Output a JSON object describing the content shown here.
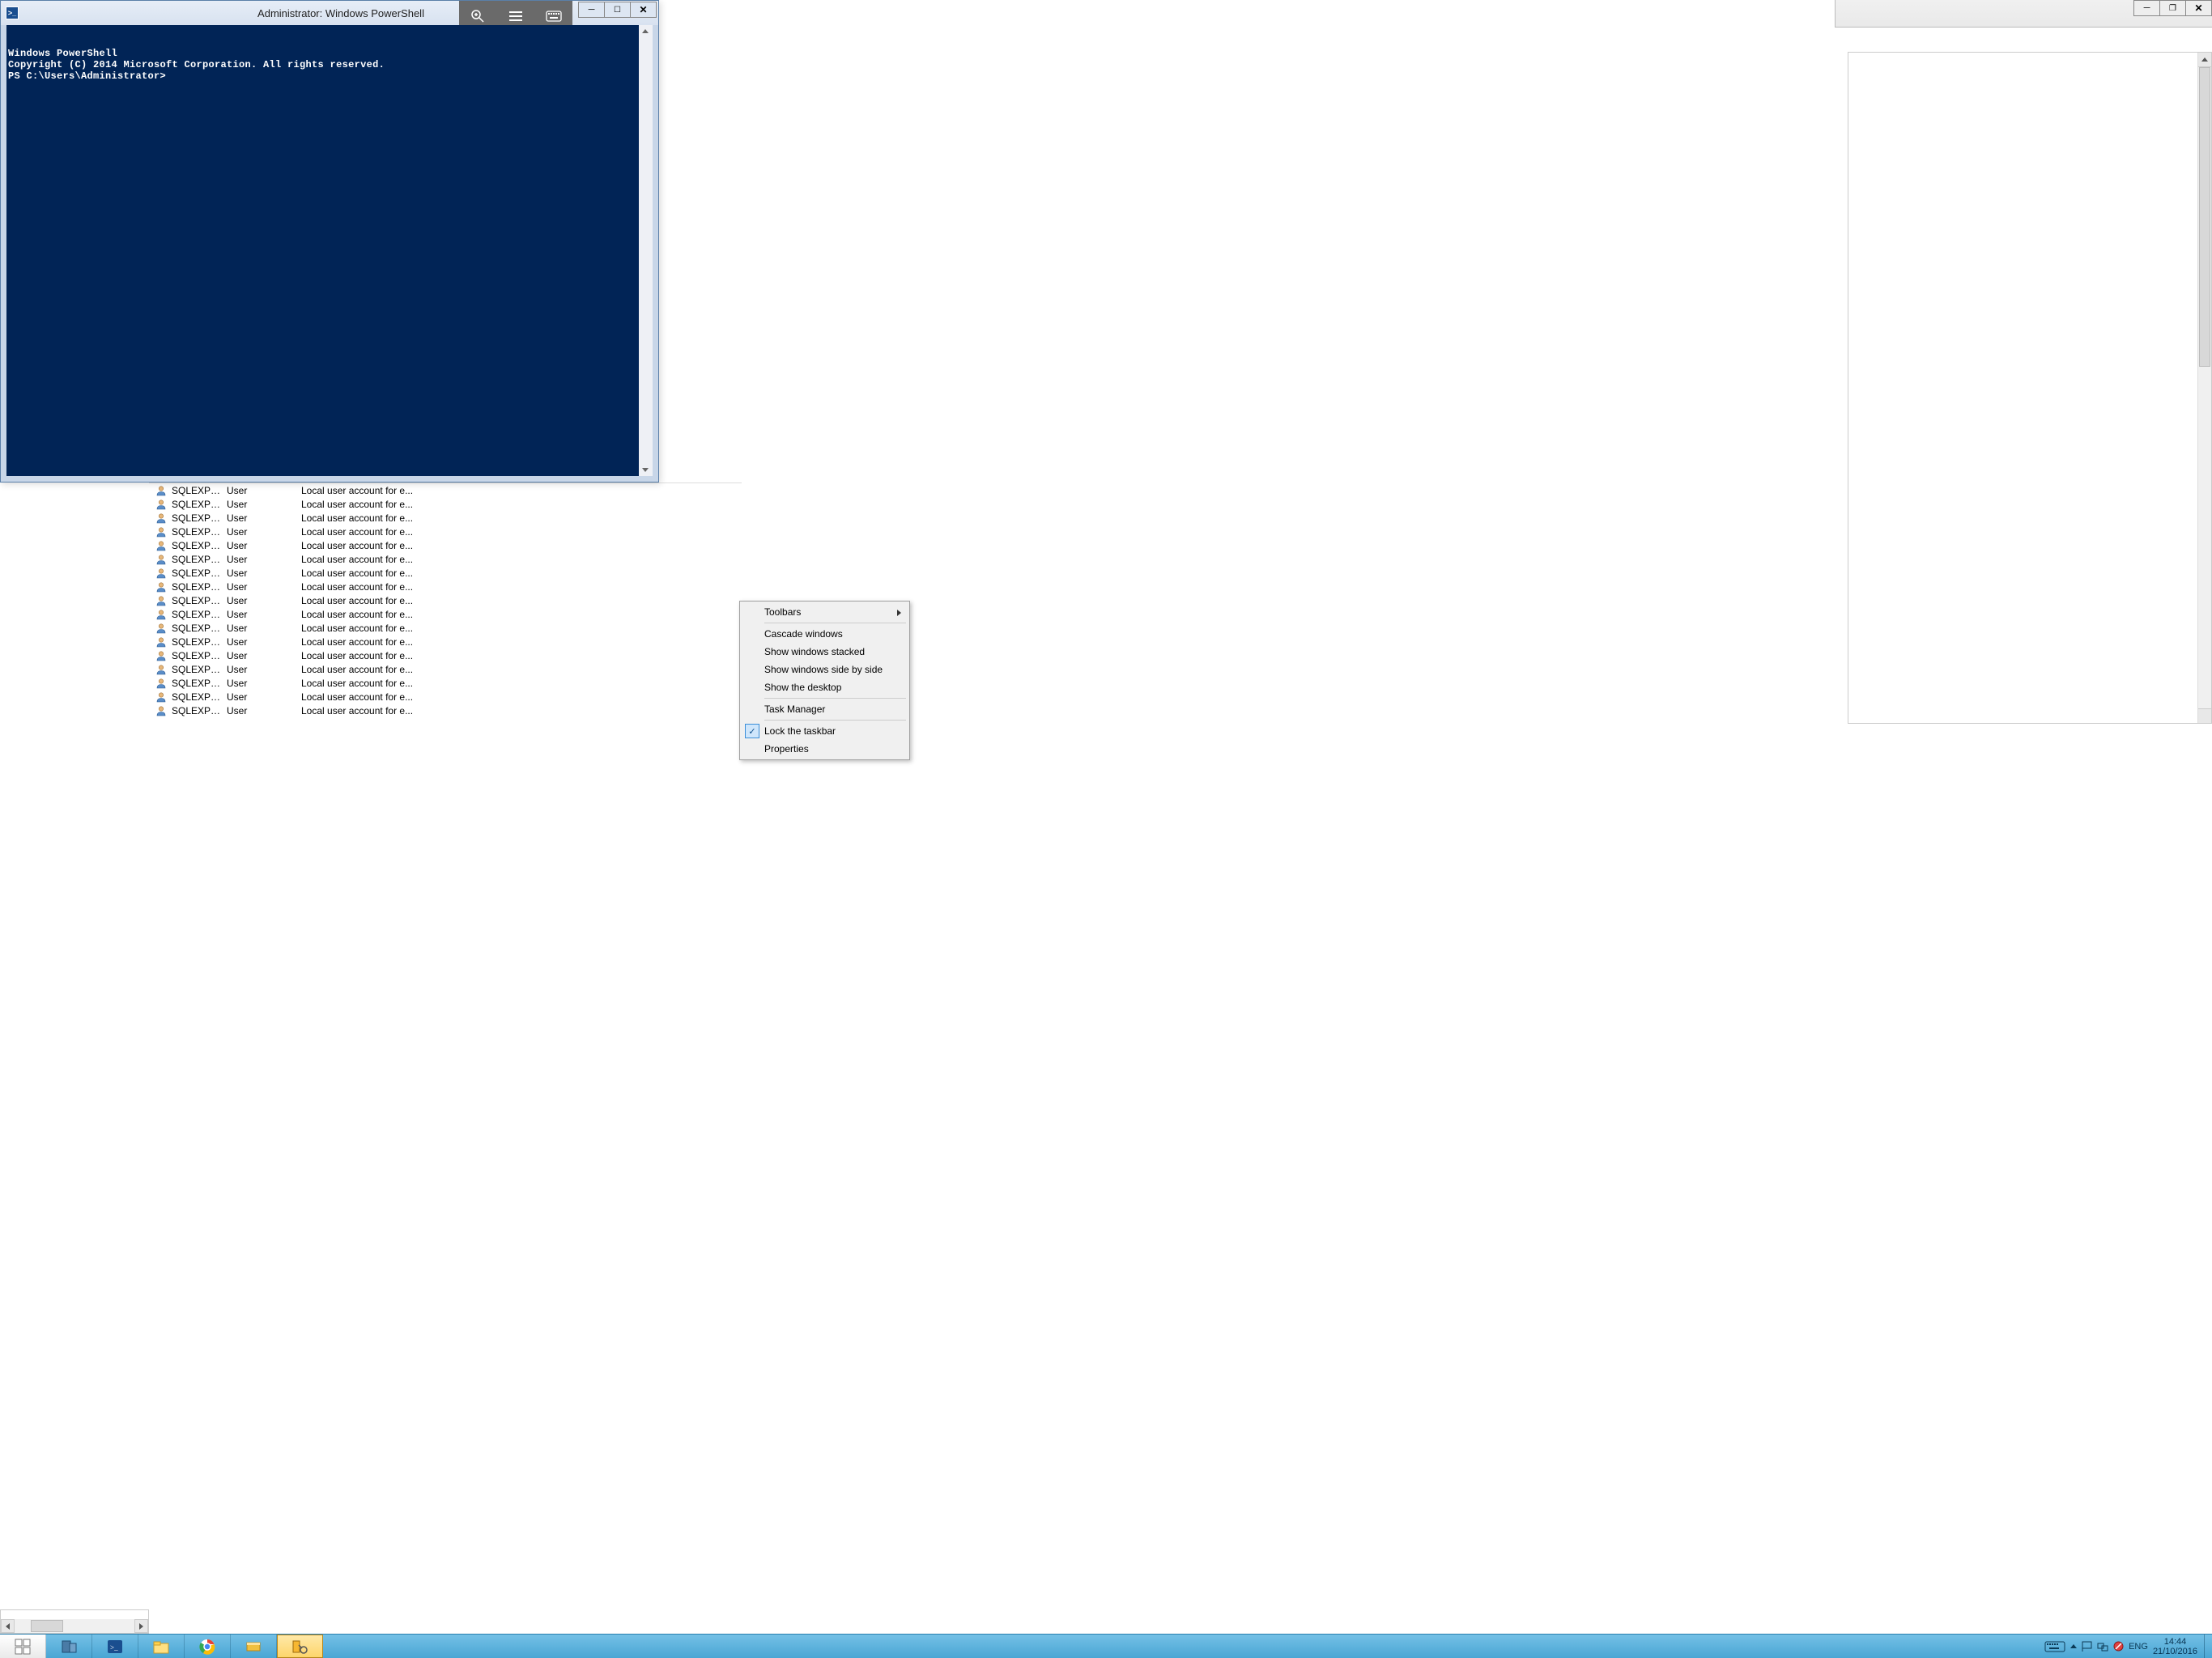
{
  "powershell": {
    "title": "Administrator: Windows PowerShell",
    "lines": [
      "Windows PowerShell",
      "Copyright (C) 2014 Microsoft Corporation. All rights reserved.",
      "",
      "PS C:\\Users\\Administrator>"
    ]
  },
  "user_list": {
    "name": "SQLEXPRESS...",
    "type": "User",
    "desc": "Local user account for e...",
    "row_count": 17
  },
  "context_menu": {
    "items": [
      {
        "label": "Toolbars",
        "submenu": true
      },
      {
        "sep": true
      },
      {
        "label": "Cascade windows"
      },
      {
        "label": "Show windows stacked"
      },
      {
        "label": "Show windows side by side"
      },
      {
        "label": "Show the desktop"
      },
      {
        "sep": true
      },
      {
        "label": "Task Manager"
      },
      {
        "sep": true
      },
      {
        "label": "Lock the taskbar",
        "checked": true
      },
      {
        "label": "Properties"
      }
    ]
  },
  "taskbar": {
    "lang": "ENG",
    "time": "14:44",
    "date": "21/10/2016"
  }
}
